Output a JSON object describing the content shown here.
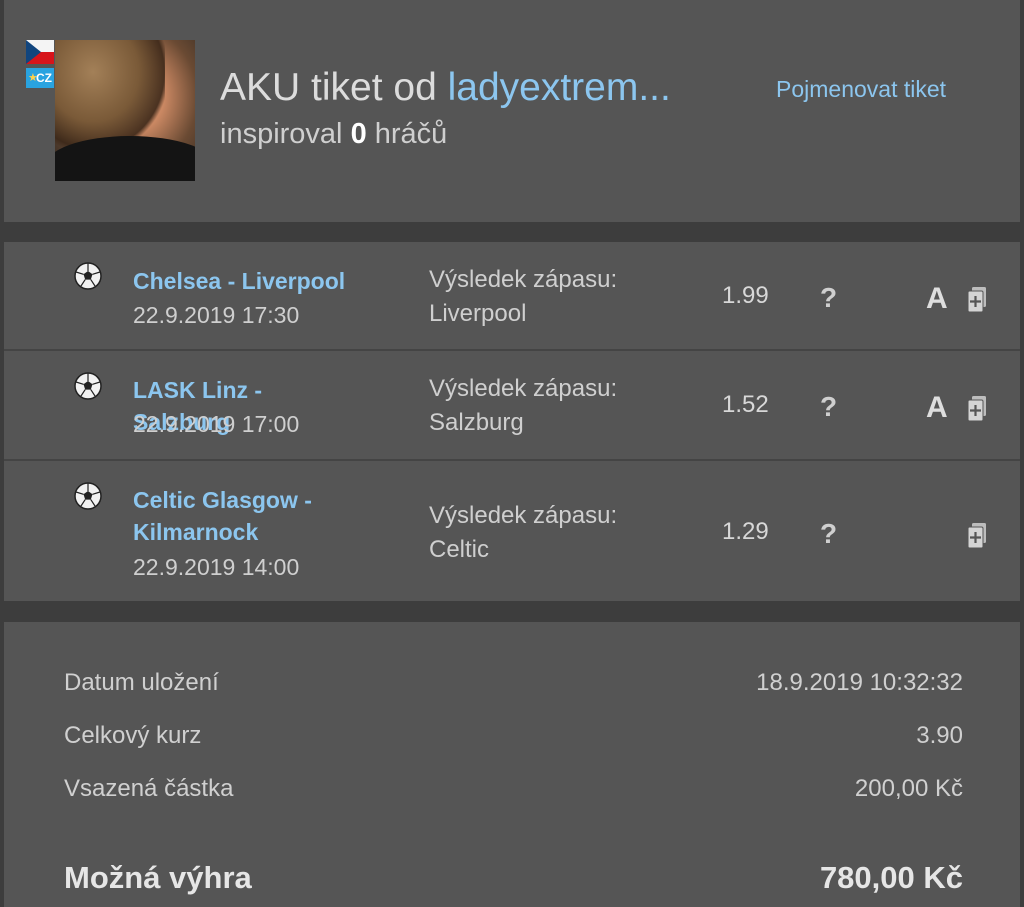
{
  "header": {
    "badge_country": "CZ",
    "title_prefix": "AKU tiket od ",
    "username": "ladyextrem...",
    "inspired_prefix": "inspiroval ",
    "inspired_count": "0",
    "inspired_suffix": " hráčů",
    "rename_link": "Pojmenovat tiket"
  },
  "bets": [
    {
      "match": "Chelsea - Liverpool",
      "date": "22.9.2019 17:30",
      "market_label": "Výsledek zápasu:",
      "selection": "Liverpool",
      "odd": "1.99",
      "help": "?",
      "badge": "A"
    },
    {
      "match": "LASK Linz - Salzburg",
      "date": "22.9.2019 17:00",
      "market_label": "Výsledek zápasu:",
      "selection": "Salzburg",
      "odd": "1.52",
      "help": "?",
      "badge": "A"
    },
    {
      "match": "Celtic Glasgow - Kilmarnock",
      "date": "22.9.2019 14:00",
      "market_label": "Výsledek zápasu:",
      "selection": "Celtic",
      "odd": "1.29",
      "help": "?",
      "badge": ""
    }
  ],
  "summary": {
    "saved_label": "Datum uložení",
    "saved_value": "18.9.2019 10:32:32",
    "total_odds_label": "Celkový kurz",
    "total_odds_value": "3.90",
    "stake_label": "Vsazená částka",
    "stake_value": "200,00 Kč",
    "win_label": "Možná výhra",
    "win_value": "780,00 Kč"
  },
  "colors": {
    "background": "#3d3d3d",
    "panel": "#555555",
    "link": "#8cc6ef",
    "text": "#d0d0d0"
  }
}
